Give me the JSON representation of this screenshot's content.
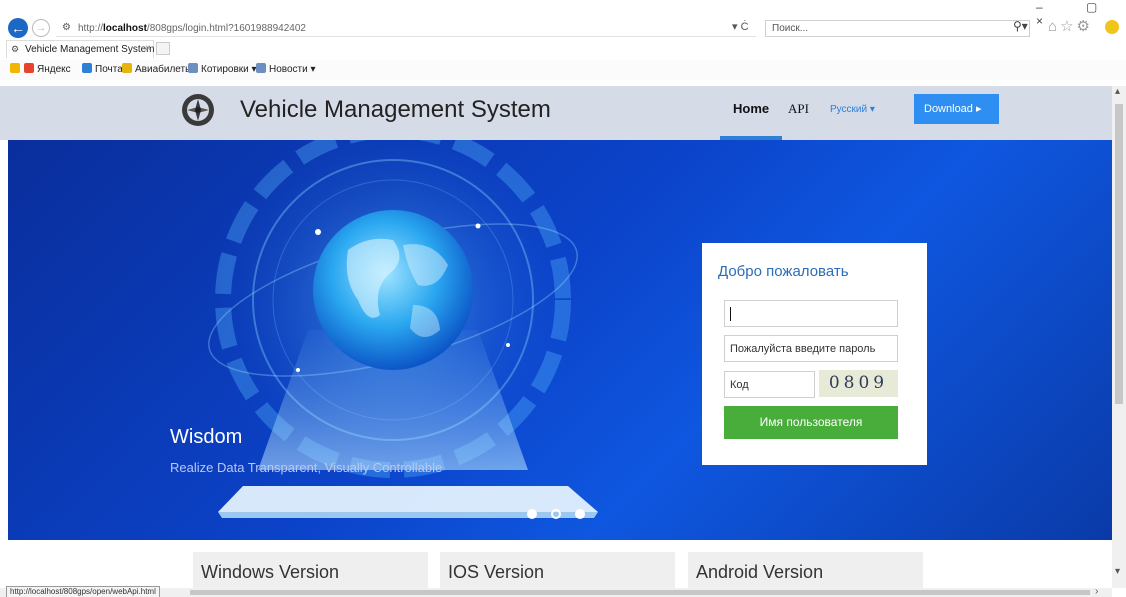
{
  "browser": {
    "url_prefix": "http://",
    "url_host": "localhost",
    "url_path": "/808gps/login.html?1601988942402",
    "url_tools": "▾ Ċ",
    "search_placeholder": "Поиск...",
    "tab_title": "Vehicle Management System",
    "tab_close": "×",
    "window_controls": "– ▢ ×",
    "favorites": [
      {
        "label": "Яндекс",
        "color": "#e8432d"
      },
      {
        "label": "Почта",
        "color": "#2e7fd6"
      },
      {
        "label": "Авиабилеты",
        "color": "#e6b40b"
      },
      {
        "label": "Котировки ▾",
        "color": "#6b8fc1"
      },
      {
        "label": "Новости ▾",
        "color": "#6b8fc1"
      }
    ],
    "status_url": "http://localhost/808gps/open/webApi.html"
  },
  "site": {
    "title": "Vehicle Management System",
    "nav": {
      "home": "Home",
      "api": "API",
      "language": "Русский ▾",
      "download": "Download ▸"
    }
  },
  "banner": {
    "headline": "Wisdom",
    "tagline": "Realize Data Transparent, Visually Controllable",
    "slide_count": 3,
    "active_slide": 2
  },
  "login": {
    "title": "Добро пожаловать",
    "username_value": "",
    "password_placeholder": "Пожалуйста введите пароль",
    "code_placeholder": "Код",
    "captcha_text": "0809",
    "submit_label": "Имя пользователя"
  },
  "versions": [
    {
      "label": "Windows Version"
    },
    {
      "label": "IOS Version"
    },
    {
      "label": "Android Version"
    }
  ],
  "colors": {
    "accent": "#2e8ef2",
    "header_bg": "#d5dbe7",
    "login_button": "#48ad3b",
    "banner_blue": "#0b43c9"
  }
}
